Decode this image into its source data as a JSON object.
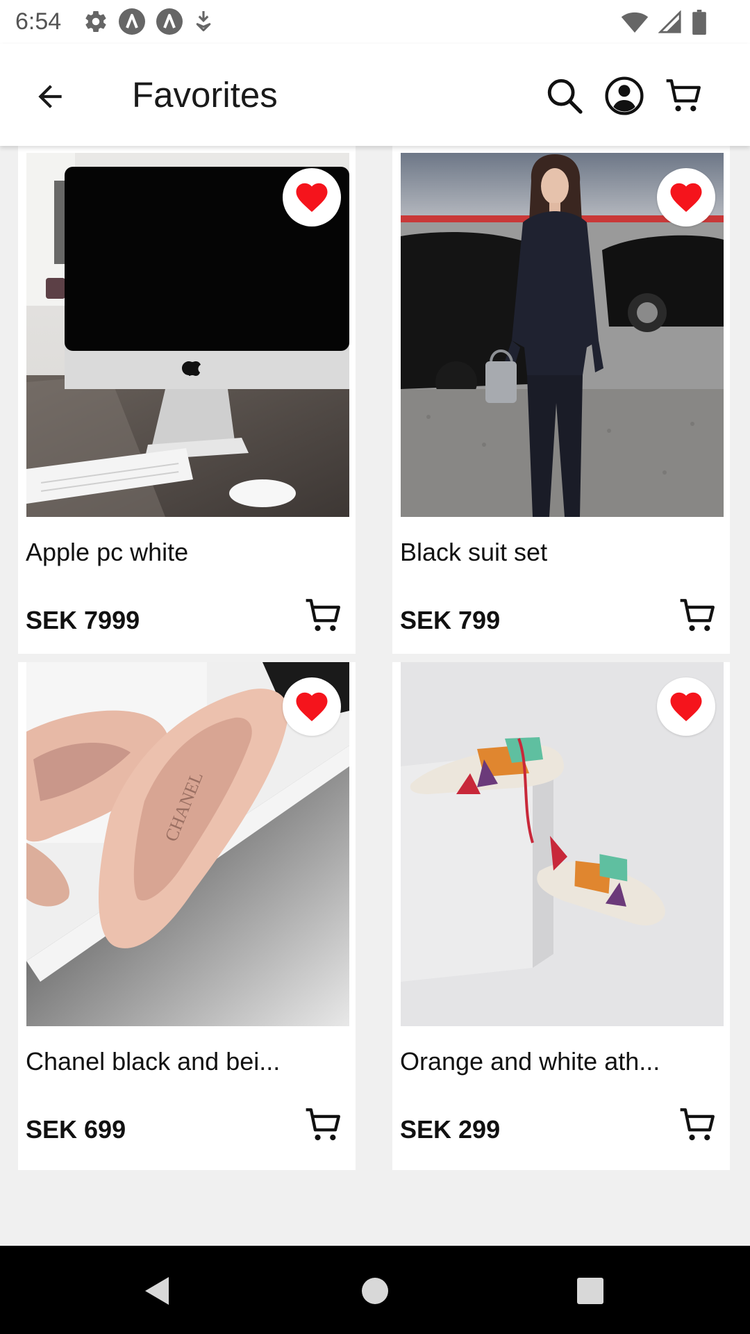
{
  "status_bar": {
    "time": "6:54",
    "left_icons": [
      "settings-gear-icon",
      "a-badge-icon",
      "a-badge-icon",
      "download-icon"
    ],
    "right_icons": [
      "wifi-icon",
      "cellular-signal-icon",
      "battery-icon"
    ]
  },
  "app_bar": {
    "title": "Favorites",
    "back_icon": "arrow-left-icon",
    "actions": [
      "search-icon",
      "account-circle-icon",
      "shopping-cart-icon"
    ]
  },
  "products": [
    {
      "name": "Apple pc white",
      "price": "SEK 7999",
      "favorited": true
    },
    {
      "name": "Black suit set",
      "price": "SEK 799",
      "favorited": true
    },
    {
      "name": "Chanel black and bei...",
      "price": "SEK 699",
      "favorited": true
    },
    {
      "name": "Orange and white ath...",
      "price": "SEK 299",
      "favorited": true
    }
  ],
  "nav_bar": [
    "back-triangle-icon",
    "home-circle-icon",
    "recents-square-icon"
  ],
  "colors": {
    "favorite_heart": "#f5141c",
    "background": "#f0f0f0",
    "card": "#ffffff",
    "nav_bar": "#000000"
  }
}
